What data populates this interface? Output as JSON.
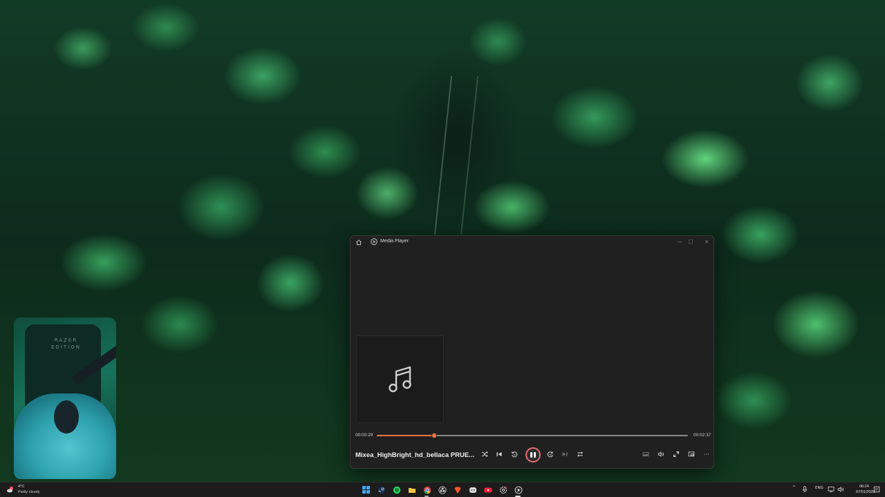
{
  "window": {
    "title": "Media Player",
    "minimize_glyph": "—",
    "maximize_glyph": "☐",
    "close_glyph": "✕"
  },
  "player": {
    "track_title": "Mixea_HighBright_hd_bellaca PRUE...",
    "elapsed": "00:00:29",
    "duration": "00:02:37",
    "progress_fraction": 0.1847,
    "state": "playing",
    "accent_color": "#f0773e",
    "play_ring_color": "#e66c74",
    "controls": [
      "shuffle-icon",
      "previous-icon",
      "rewind-10-icon",
      "pause-icon",
      "forward-30-icon",
      "next-icon",
      "repeat-icon"
    ],
    "right_controls": [
      "miniplayer-icon",
      "volume-icon",
      "fullscreen-icon",
      "cast-icon",
      "more-icon"
    ],
    "more_glyph": "···"
  },
  "webcam": {
    "chair_brand": "RAZER",
    "chair_edition": "EDITION"
  },
  "taskbar": {
    "weather": {
      "temp": "4°C",
      "condition": "Partly cloudy"
    },
    "apps": [
      "windows-start-icon",
      "steam-icon",
      "spotify-icon",
      "file-explorer-icon",
      "chrome-icon",
      "obs-icon",
      "brave-icon",
      "discord-icon",
      "store-icon",
      "youtube-icon",
      "settings-icon",
      "media-player-icon"
    ],
    "tray": {
      "chevron": "^",
      "language": "ENG"
    },
    "clock": {
      "time": "06:24",
      "date": "07/01/2026"
    }
  }
}
